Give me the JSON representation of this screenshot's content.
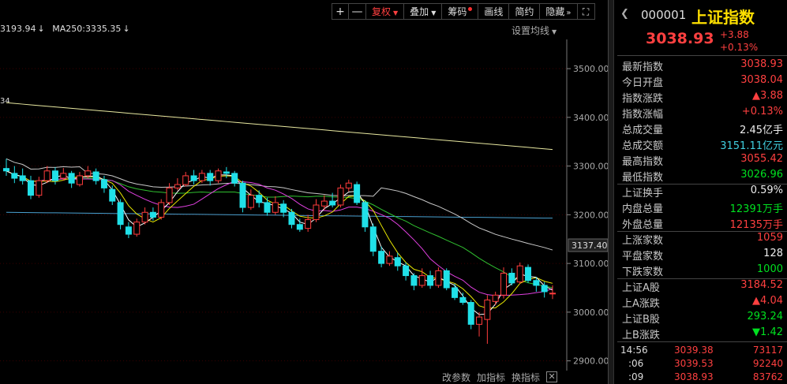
{
  "toolbar": {
    "items": [
      {
        "label": "+"
      },
      {
        "label": "—"
      },
      {
        "label": "复权"
      },
      {
        "label": "叠加"
      },
      {
        "label": "筹码"
      },
      {
        "label": "画线"
      },
      {
        "label": "简约"
      },
      {
        "label": "隐藏"
      }
    ],
    "more_icon": "chevron-double-right",
    "fullscreen_icon": "expand-icon"
  },
  "ma_bar": {
    "ma_prev": "3193.94",
    "ma250_label": "MA250:",
    "ma250_value": "3335.35",
    "settings_label": "设置均线"
  },
  "bottom_bar": {
    "params": "改参数",
    "add": "加指标",
    "switch": "换指标"
  },
  "header": {
    "code": "000001",
    "name": "上证指数",
    "price": "3038.93",
    "change": "+3.88",
    "change_pct": "+0.13%"
  },
  "stats": [
    {
      "label": "最新指数",
      "value": "3038.93",
      "color": "red"
    },
    {
      "label": "今日开盘",
      "value": "3038.04",
      "color": "red"
    },
    {
      "label": "指数涨跌",
      "value": "▲3.88",
      "color": "red"
    },
    {
      "label": "指数涨幅",
      "value": "+0.13%",
      "color": "red"
    },
    {
      "label": "总成交量",
      "value": "2.45亿手",
      "color": "white"
    },
    {
      "label": "总成交额",
      "value": "3151.11亿元",
      "color": "cyan"
    },
    {
      "label": "最高指数",
      "value": "3055.42",
      "color": "red"
    },
    {
      "label": "最低指数",
      "value": "3026.96",
      "color": "green"
    }
  ],
  "stats2": [
    {
      "label": "上证换手",
      "value": "0.59%",
      "color": "white"
    },
    {
      "label": "内盘总量",
      "value": "12391万手",
      "color": "green"
    },
    {
      "label": "外盘总量",
      "value": "12135万手",
      "color": "red"
    }
  ],
  "stats3": [
    {
      "label": "上涨家数",
      "value": "1059",
      "color": "red"
    },
    {
      "label": "平盘家数",
      "value": "128",
      "color": "white"
    },
    {
      "label": "下跌家数",
      "value": "1000",
      "color": "green"
    }
  ],
  "stats4": [
    {
      "label": "上证A股",
      "value": "3184.52",
      "color": "red"
    },
    {
      "label": "上A涨跌",
      "value": "▲4.04",
      "color": "red"
    },
    {
      "label": "上证B股",
      "value": "293.24",
      "color": "green"
    },
    {
      "label": "上B涨跌",
      "value": "▼1.42",
      "color": "green"
    }
  ],
  "ticks": [
    {
      "time": "14:56",
      "price": "3039.38",
      "vol": "73117"
    },
    {
      "time": ":06",
      "price": "3039.53",
      "vol": "92240"
    },
    {
      "time": ":09",
      "price": "3038.93",
      "vol": "83762"
    }
  ],
  "chart_data": {
    "type": "candlestick",
    "y_ticks": [
      "3500.00",
      "3400.00",
      "3300.00",
      "3200.00",
      "3100.00",
      "3000.00",
      "2900.00"
    ],
    "y_tick_values": [
      3500,
      3400,
      3300,
      3200,
      3100,
      3000,
      2900
    ],
    "current_price_label": "3137.40",
    "current_price_value": 3137.4,
    "left_edge_label": "34",
    "ylim": [
      2880,
      3560
    ],
    "candles": [
      [
        3295,
        3290,
        3315,
        3280
      ],
      [
        3285,
        3275,
        3300,
        3265
      ],
      [
        3280,
        3270,
        3295,
        3262
      ],
      [
        3270,
        3240,
        3280,
        3232
      ],
      [
        3240,
        3270,
        3278,
        3235
      ],
      [
        3270,
        3290,
        3300,
        3265
      ],
      [
        3290,
        3270,
        3298,
        3262
      ],
      [
        3275,
        3285,
        3296,
        3270
      ],
      [
        3285,
        3265,
        3290,
        3255
      ],
      [
        3262,
        3280,
        3288,
        3258
      ],
      [
        3280,
        3290,
        3300,
        3275
      ],
      [
        3288,
        3270,
        3295,
        3262
      ],
      [
        3272,
        3255,
        3280,
        3245
      ],
      [
        3252,
        3228,
        3260,
        3220
      ],
      [
        3225,
        3180,
        3232,
        3170
      ],
      [
        3175,
        3160,
        3185,
        3152
      ],
      [
        3160,
        3185,
        3192,
        3155
      ],
      [
        3185,
        3205,
        3215,
        3180
      ],
      [
        3205,
        3195,
        3215,
        3188
      ],
      [
        3195,
        3225,
        3232,
        3190
      ],
      [
        3225,
        3255,
        3265,
        3220
      ],
      [
        3255,
        3262,
        3275,
        3250
      ],
      [
        3262,
        3280,
        3288,
        3258
      ],
      [
        3280,
        3270,
        3292,
        3262
      ],
      [
        3270,
        3285,
        3292,
        3265
      ],
      [
        3285,
        3270,
        3292,
        3260
      ],
      [
        3270,
        3290,
        3295,
        3265
      ],
      [
        3288,
        3285,
        3298,
        3275
      ],
      [
        3285,
        3265,
        3290,
        3258
      ],
      [
        3265,
        3215,
        3270,
        3205
      ],
      [
        3215,
        3240,
        3252,
        3210
      ],
      [
        3240,
        3225,
        3250,
        3215
      ],
      [
        3225,
        3205,
        3235,
        3198
      ],
      [
        3205,
        3225,
        3238,
        3200
      ],
      [
        3222,
        3205,
        3230,
        3195
      ],
      [
        3205,
        3180,
        3212,
        3172
      ],
      [
        3180,
        3170,
        3192,
        3165
      ],
      [
        3172,
        3190,
        3200,
        3165
      ],
      [
        3190,
        3220,
        3232,
        3185
      ],
      [
        3218,
        3228,
        3240,
        3210
      ],
      [
        3228,
        3220,
        3245,
        3215
      ],
      [
        3220,
        3255,
        3262,
        3215
      ],
      [
        3255,
        3265,
        3272,
        3248
      ],
      [
        3262,
        3225,
        3268,
        3220
      ],
      [
        3225,
        3175,
        3230,
        3165
      ],
      [
        3175,
        3125,
        3182,
        3115
      ],
      [
        3125,
        3100,
        3135,
        3092
      ],
      [
        3100,
        3115,
        3125,
        3095
      ],
      [
        3112,
        3095,
        3122,
        3085
      ],
      [
        3095,
        3075,
        3102,
        3065
      ],
      [
        3075,
        3055,
        3080,
        3045
      ],
      [
        3055,
        3075,
        3090,
        3050
      ],
      [
        3075,
        3055,
        3085,
        3048
      ],
      [
        3055,
        3085,
        3092,
        3050
      ],
      [
        3085,
        3050,
        3090,
        3045
      ],
      [
        3050,
        3030,
        3058,
        3025
      ],
      [
        3030,
        3020,
        3040,
        3015
      ],
      [
        3020,
        2975,
        3025,
        2965
      ],
      [
        2975,
        2990,
        3000,
        2950
      ],
      [
        2985,
        3025,
        3035,
        2935
      ],
      [
        3022,
        3035,
        3042,
        3015
      ],
      [
        3035,
        3080,
        3092,
        3028
      ],
      [
        3080,
        3060,
        3090,
        3055
      ],
      [
        3062,
        3095,
        3102,
        3058
      ],
      [
        3092,
        3065,
        3098,
        3060
      ],
      [
        3065,
        3055,
        3072,
        3042
      ],
      [
        3055,
        3042,
        3062,
        3030
      ],
      [
        3038,
        3039,
        3055,
        3027
      ]
    ]
  }
}
